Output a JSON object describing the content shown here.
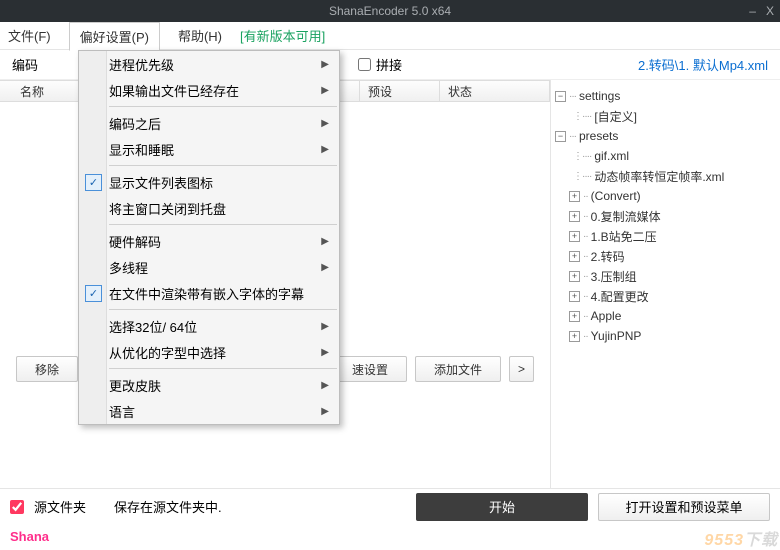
{
  "window": {
    "title": "ShanaEncoder 5.0 x64",
    "minimize": "–",
    "close": "X"
  },
  "menubar": {
    "file": "文件(F)",
    "prefs": "偏好设置(P)",
    "help": "帮助(H)",
    "update": "[有新版本可用]"
  },
  "subbar": {
    "encoding": "编码",
    "splice_label": "拼接",
    "right_link": "2.转码\\1. 默认Mp4.xml"
  },
  "columns": {
    "name": "名称",
    "preset": "预设",
    "status": "状态"
  },
  "dropdown": [
    {
      "label": "进程优先级",
      "sub": true
    },
    {
      "label": "如果输出文件已经存在",
      "sub": true
    },
    {
      "sep": true
    },
    {
      "label": "编码之后",
      "sub": true
    },
    {
      "label": "显示和睡眠",
      "sub": true
    },
    {
      "sep": true
    },
    {
      "label": "显示文件列表图标",
      "check": true
    },
    {
      "label": "将主窗口关闭到托盘"
    },
    {
      "sep": true
    },
    {
      "label": "硬件解码",
      "sub": true
    },
    {
      "label": "多线程",
      "sub": true
    },
    {
      "label": "在文件中渲染带有嵌入字体的字幕",
      "check": true
    },
    {
      "sep": true
    },
    {
      "label": "选择32位/ 64位",
      "sub": true
    },
    {
      "label": "从优化的字型中选择",
      "sub": true
    },
    {
      "sep": true
    },
    {
      "label": "更改皮肤",
      "sub": true
    },
    {
      "label": "语言",
      "sub": true
    }
  ],
  "buttons": {
    "remove": "移除",
    "quick": "速设置",
    "add": "添加文件",
    "gt": ">"
  },
  "tree": {
    "settings": "settings",
    "custom": "[自定义]",
    "presets": "presets",
    "gif": "gif.xml",
    "dyn": "动态帧率转恒定帧率.xml",
    "convert": "(Convert)",
    "copy": "0.复制流媒体",
    "bili": "1.B站免二压",
    "transcode": "2.转码",
    "compress": "3.压制组",
    "config": "4.配置更改",
    "apple": "Apple",
    "yujin": "YujinPNP"
  },
  "footer": {
    "source": "源文件夹",
    "save": "保存在源文件夹中.",
    "start": "开始",
    "open": "打开设置和预设菜单"
  },
  "brand": "Shana",
  "watermark_a": "9553",
  "watermark_b": "下载"
}
